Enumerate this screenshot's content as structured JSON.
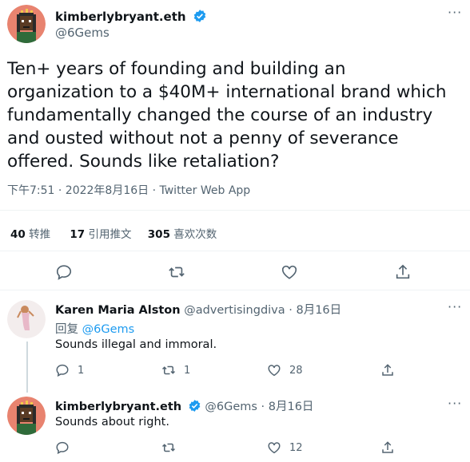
{
  "main_tweet": {
    "author_name": "kimberlybryant.eth",
    "author_handle": "@6Gems",
    "text": "Ten+ years of founding and building an organization to a $40M+ international brand which fundamentally changed the course of an industry and ousted without not a penny of severance offered. Sounds like retaliation?",
    "timestamp": "下午7:51 · 2022年8月16日 · Twitter Web App",
    "stats": {
      "retweets_count": "40",
      "retweets_label": "转推",
      "quotes_count": "17",
      "quotes_label": "引用推文",
      "likes_count": "305",
      "likes_label": "喜欢次数"
    }
  },
  "replies": [
    {
      "author_name": "Karen Maria Alston",
      "author_handle": "@advertisingdiva",
      "date": "8月16日",
      "reply_to_prefix": "回复",
      "reply_to_handle": "@6Gems",
      "text": "Sounds illegal and immoral.",
      "reply_count": "1",
      "retweet_count": "1",
      "like_count": "28"
    },
    {
      "author_name": "kimberlybryant.eth",
      "author_handle": "@6Gems",
      "date": "8月16日",
      "text": "Sounds about right.",
      "reply_count": "",
      "retweet_count": "",
      "like_count": "12"
    }
  ],
  "icons": [
    "verified-badge-icon",
    "more-icon",
    "reply-icon",
    "retweet-icon",
    "like-icon",
    "share-icon"
  ],
  "colors": {
    "accent": "#1d9bf0",
    "text": "#0f1419",
    "muted": "#536471",
    "divider": "#eff3f4"
  }
}
